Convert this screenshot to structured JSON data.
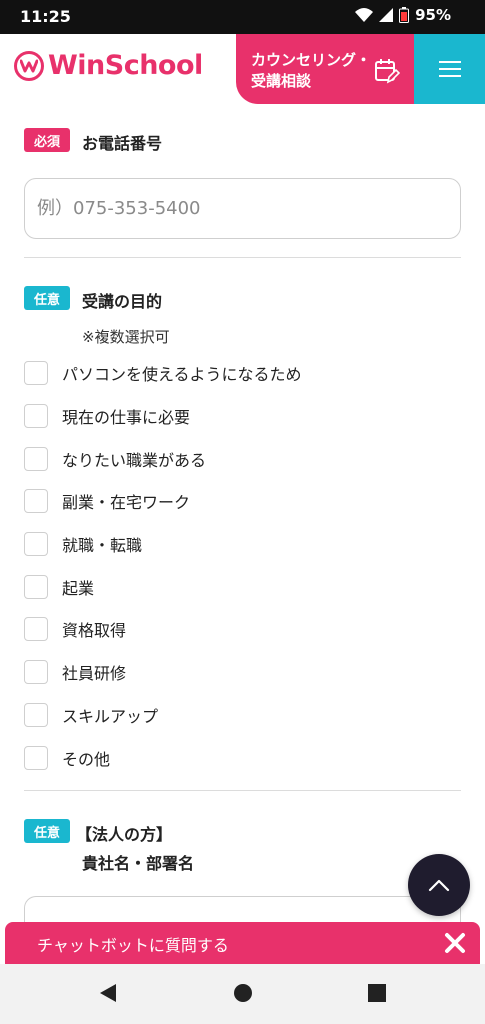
{
  "status_bar": {
    "time": "11:25",
    "battery": "95%"
  },
  "header": {
    "logo_text": "WinSchool",
    "counseling_button_label": "カウンセリング・受講相談"
  },
  "phone_field": {
    "badge": "必須",
    "label": "お電話番号",
    "placeholder": "例）075-353-5400"
  },
  "purpose_field": {
    "badge": "任意",
    "label": "受講の目的",
    "note": "※複数選択可",
    "options": [
      "パソコンを使えるようになるため",
      "現在の仕事に必要",
      "なりたい職業がある",
      "副業・在宅ワーク",
      "就職・転職",
      "起業",
      "資格取得",
      "社員研修",
      "スキルアップ",
      "その他"
    ]
  },
  "company_field": {
    "badge": "任意",
    "label_line1": "【法人の方】",
    "label_line2": "貴社名・部署名"
  },
  "chatbot": {
    "label": "チャットボットに質問する"
  },
  "colors": {
    "accent_pink": "#e8316b",
    "accent_cyan": "#1ab7cf"
  }
}
